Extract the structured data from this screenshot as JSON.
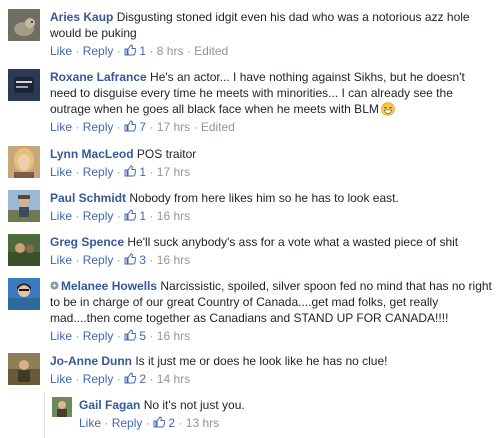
{
  "actions": {
    "like_label": "Like",
    "reply_label": "Reply",
    "separator": "·"
  },
  "comments": [
    {
      "name": "Aries Kaup",
      "text": "Disgusting stoned idgit even his dad who was a notorious azz hole would be puking",
      "likes": "1",
      "time": "8 hrs",
      "edited": "Edited"
    },
    {
      "name": "Roxane Lafrance",
      "text": "He's an actor... I have nothing against Sikhs, but he doesn't need to disguise every time he meets with minorities... I can already see the outrage when he goes all black face when he meets with BLM",
      "likes": "7",
      "time": "17 hrs",
      "edited": "Edited",
      "emoji": "grinning-sweat-emoji"
    },
    {
      "name": "Lynn MacLeod",
      "text": "POS traitor",
      "likes": "1",
      "time": "17 hrs"
    },
    {
      "name": "Paul Schmidt",
      "text": "Nobody from here likes him so he has to look east.",
      "likes": "1",
      "time": "16 hrs"
    },
    {
      "name": "Greg Spence",
      "text": "He'll suck anybody's ass for a vote what a wasted piece of shit",
      "likes": "3",
      "time": "16 hrs"
    },
    {
      "name": "Melanee Howells",
      "text": "Narcissistic, spoiled, silver spoon fed no mind that has no right to be in charge of our great Country of Canada....get mad folks, get really mad....then come together as Canadians and STAND UP FOR CANADA!!!!",
      "likes": "5",
      "time": "16 hrs",
      "icon": "follow-icon"
    },
    {
      "name": "Jo-Anne Dunn",
      "text": "Is it just me or does he look like he has no clue!",
      "likes": "2",
      "time": "14 hrs"
    },
    {
      "name": "Gail Fagan",
      "text": "No it's not just you.",
      "likes": "2",
      "time": "13 hrs"
    }
  ],
  "colors": {
    "name": "#365899",
    "link": "#4267b2",
    "meta": "#90949c",
    "text": "#1d2129"
  }
}
